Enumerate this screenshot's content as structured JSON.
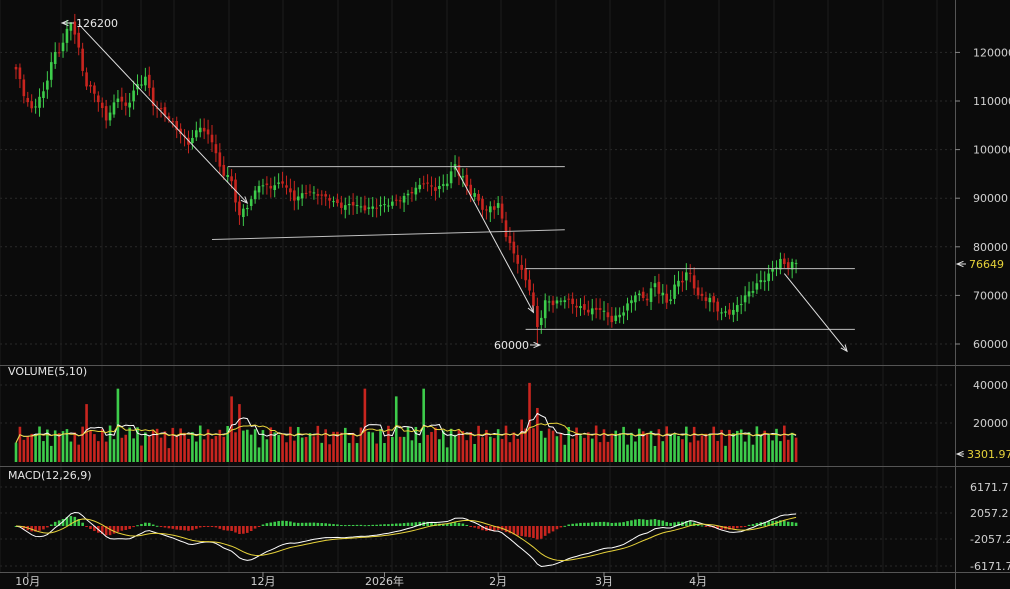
{
  "panels": {
    "volume_label": "VOLUME(5,10)",
    "macd_label": "MACD(12,26,9)"
  },
  "annotations": {
    "high_label": "126200",
    "low_label": "60000",
    "last_price_label": "76649",
    "last_volume_label": "3301.97"
  },
  "colors": {
    "background": "#0b0b0b",
    "up": "#3dcc4b",
    "down": "#c8251f",
    "ma_white": "#ffffff",
    "ma_yellow": "#e6d23a",
    "last_price": "#e6d23a",
    "grid": "#2a2a2a"
  },
  "chart_data": {
    "type": "candlestick",
    "price_axis": {
      "ticks": [
        120000,
        110000,
        100000,
        90000,
        80000,
        70000,
        60000
      ],
      "tick_labels": [
        "120000",
        "110000",
        "100000",
        "90000",
        "80000",
        "70000",
        "60000"
      ]
    },
    "volume_axis": {
      "ticks": [
        40000,
        20000
      ],
      "tick_labels": [
        "40000",
        "20000"
      ]
    },
    "macd_axis": {
      "ticks": [
        6171.7,
        2057.2,
        -2057.2,
        -6171.7
      ],
      "tick_labels": [
        "6171.7",
        "2057.2",
        "-2057.2",
        "-6171.7"
      ]
    },
    "x_axis": {
      "labels": [
        "10月",
        "12月",
        "2026年",
        "2月",
        "3月",
        "4月"
      ],
      "label_bar_index": [
        3,
        63,
        94,
        123,
        150,
        174
      ]
    },
    "high": 126200,
    "low": 60000,
    "last_price": 76649,
    "last_volume": 3301.97,
    "anchors": [
      [
        0,
        116500
      ],
      [
        2,
        111000
      ],
      [
        4,
        108500
      ],
      [
        7,
        112000
      ],
      [
        9,
        118000
      ],
      [
        12,
        122000
      ],
      [
        14,
        126200
      ],
      [
        16,
        121000
      ],
      [
        18,
        113000
      ],
      [
        20,
        111500
      ],
      [
        23,
        106000
      ],
      [
        26,
        110500
      ],
      [
        28,
        109000
      ],
      [
        31,
        113500
      ],
      [
        33,
        115000
      ],
      [
        35,
        109000
      ],
      [
        38,
        107000
      ],
      [
        41,
        104000
      ],
      [
        44,
        101000
      ],
      [
        47,
        104500
      ],
      [
        50,
        101500
      ],
      [
        52,
        96500
      ],
      [
        55,
        93500
      ],
      [
        57,
        86500
      ],
      [
        59,
        88000
      ],
      [
        62,
        92500
      ],
      [
        65,
        92000
      ],
      [
        68,
        93000
      ],
      [
        71,
        89500
      ],
      [
        74,
        91000
      ],
      [
        77,
        90500
      ],
      [
        80,
        89500
      ],
      [
        83,
        88000
      ],
      [
        86,
        88500
      ],
      [
        89,
        87500
      ],
      [
        92,
        88000
      ],
      [
        95,
        88500
      ],
      [
        98,
        89500
      ],
      [
        101,
        91000
      ],
      [
        104,
        93000
      ],
      [
        107,
        91500
      ],
      [
        110,
        93000
      ],
      [
        112,
        97000
      ],
      [
        115,
        92500
      ],
      [
        118,
        89500
      ],
      [
        120,
        87500
      ],
      [
        123,
        89000
      ],
      [
        125,
        82000
      ],
      [
        128,
        76500
      ],
      [
        131,
        71000
      ],
      [
        133,
        63500
      ],
      [
        135,
        69000
      ],
      [
        137,
        68000
      ],
      [
        140,
        69000
      ],
      [
        143,
        67500
      ],
      [
        146,
        66500
      ],
      [
        149,
        67000
      ],
      [
        152,
        64500
      ],
      [
        155,
        66500
      ],
      [
        158,
        70000
      ],
      [
        161,
        69000
      ],
      [
        163,
        72500
      ],
      [
        166,
        68500
      ],
      [
        169,
        73000
      ],
      [
        172,
        74500
      ],
      [
        174,
        70000
      ],
      [
        177,
        69500
      ],
      [
        180,
        66500
      ],
      [
        183,
        67000
      ],
      [
        186,
        70000
      ],
      [
        189,
        72500
      ],
      [
        192,
        74500
      ],
      [
        195,
        77500
      ],
      [
        197,
        75500
      ],
      [
        199,
        76649
      ]
    ],
    "channels": [
      {
        "from": [
          54,
          96500
        ],
        "to": [
          140,
          96500
        ]
      },
      {
        "from": [
          50,
          81500
        ],
        "to": [
          140,
          83500
        ]
      },
      {
        "from": [
          130,
          75500
        ],
        "to": [
          214,
          75500
        ]
      },
      {
        "from": [
          130,
          63000
        ],
        "to": [
          214,
          63000
        ]
      }
    ],
    "trend_arrows": [
      {
        "from": [
          16,
          125800
        ],
        "to": [
          59,
          89000
        ]
      },
      {
        "from": [
          112,
          96500
        ],
        "to": [
          132,
          66500
        ]
      },
      {
        "from": [
          196,
          74500
        ],
        "to": [
          212,
          58500
        ]
      }
    ]
  }
}
